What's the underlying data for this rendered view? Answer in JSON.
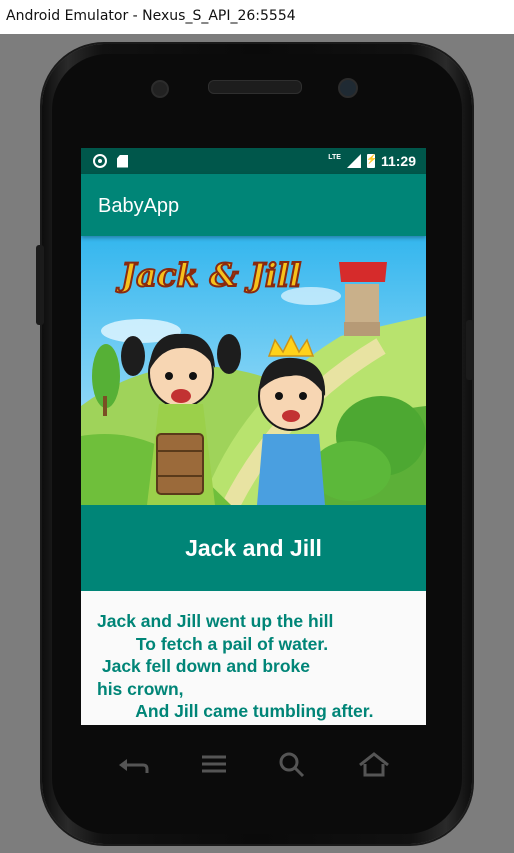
{
  "window": {
    "title": "Android Emulator - Nexus_S_API_26:5554"
  },
  "status_bar": {
    "network": "LTE",
    "time": "11:29",
    "icons": [
      "circle-notification-icon",
      "sd-card-icon",
      "signal-icon",
      "battery-charging-icon"
    ]
  },
  "app_bar": {
    "title": "BabyApp"
  },
  "hero": {
    "logo_text": "Jack & Jill"
  },
  "song": {
    "title": "Jack and Jill",
    "lyrics": "Jack and Jill went up the hill\n        To fetch a pail of water.\n Jack fell down and broke\nhis crown,\n        And Jill came tumbling after."
  },
  "nav_keys": [
    "back-icon",
    "menu-icon",
    "search-icon",
    "home-icon"
  ],
  "colors": {
    "primary": "#008577",
    "primary_dark": "#00574b",
    "lyrics_text": "#008577"
  }
}
